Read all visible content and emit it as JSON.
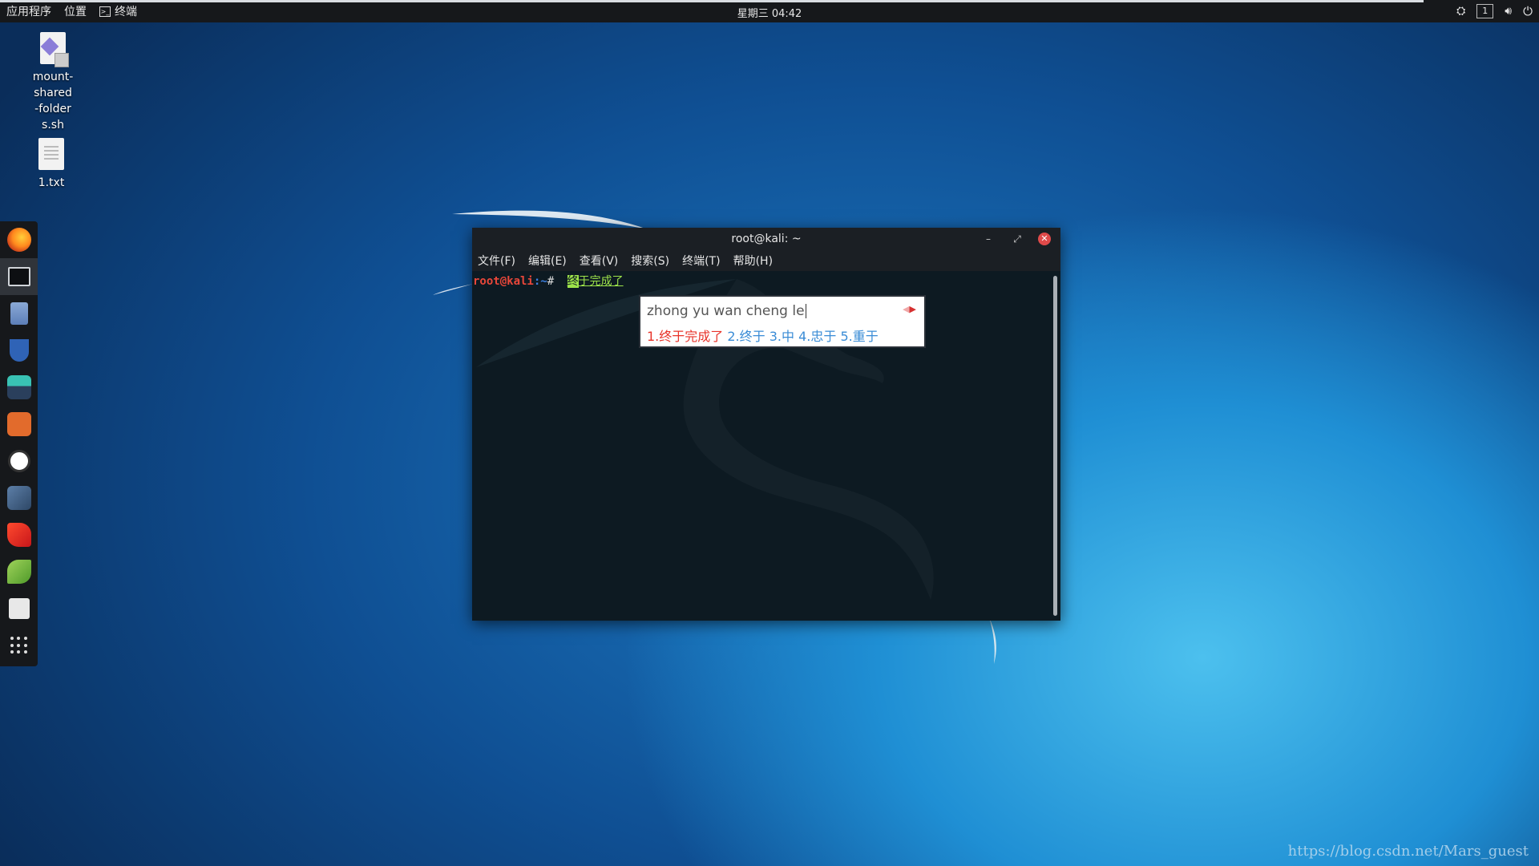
{
  "topbar": {
    "apps": "应用程序",
    "places": "位置",
    "terminal": "终端",
    "clock": "星期三 04:42",
    "workspace": "1"
  },
  "desktop": {
    "icons": [
      {
        "label": "mount-shared-folders.sh",
        "icon": "shell-script-icon"
      },
      {
        "label": "1.txt",
        "icon": "text-file-icon"
      }
    ]
  },
  "dock": {
    "items": [
      "firefox-icon",
      "terminal-icon",
      "files-icon",
      "metasploit-icon",
      "armitage-icon",
      "burpsuite-icon",
      "faraday-icon",
      "maltego-icon",
      "cherrytree-icon",
      "leafpad-icon",
      "recordmydesktop-icon",
      "show-applications-icon"
    ],
    "active": "terminal-icon"
  },
  "terminal": {
    "title": "root@kali: ~",
    "menu": [
      "文件(F)",
      "编辑(E)",
      "查看(V)",
      "搜索(S)",
      "终端(T)",
      "帮助(H)"
    ],
    "prompt_user": "root@kali",
    "prompt_path": ":~",
    "prompt_hash": "#",
    "input_first": "终",
    "input_rest": "于完成了"
  },
  "ime": {
    "pinyin": "zhong yu wan cheng le",
    "candidates": [
      "1.终于完成了",
      "2.终于",
      "3.中",
      "4.忠于",
      "5.重于"
    ],
    "selected_index": 0
  },
  "watermark": "https://blog.csdn.net/Mars_guest",
  "colors": {
    "prompt_user": "#e8473a",
    "prompt_path": "#3b7fe0",
    "input": "#9de34a",
    "ime_selected": "#e8342a",
    "ime_candidate": "#3a8cd6"
  }
}
